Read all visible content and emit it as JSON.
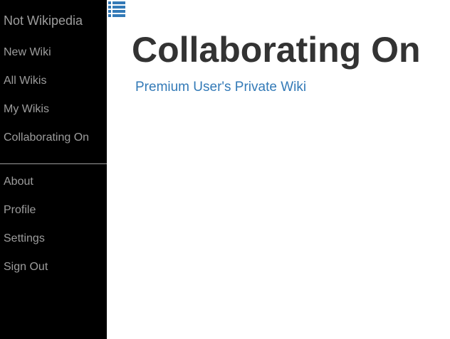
{
  "sidebar": {
    "brand": "Not Wikipedia",
    "primary_items": [
      {
        "label": "New Wiki"
      },
      {
        "label": "All Wikis"
      },
      {
        "label": "My Wikis"
      },
      {
        "label": "Collaborating On"
      }
    ],
    "secondary_items": [
      {
        "label": "About"
      },
      {
        "label": "Profile"
      },
      {
        "label": "Settings"
      },
      {
        "label": "Sign Out"
      }
    ]
  },
  "header": {
    "menu_icon": "list-icon"
  },
  "main": {
    "title": "Collaborating On",
    "wikis": [
      {
        "label": "Premium User's Private Wiki"
      }
    ]
  },
  "colors": {
    "sidebar_bg": "#000000",
    "sidebar_text": "#9d9d9d",
    "link": "#337ab7",
    "title": "#333333"
  }
}
